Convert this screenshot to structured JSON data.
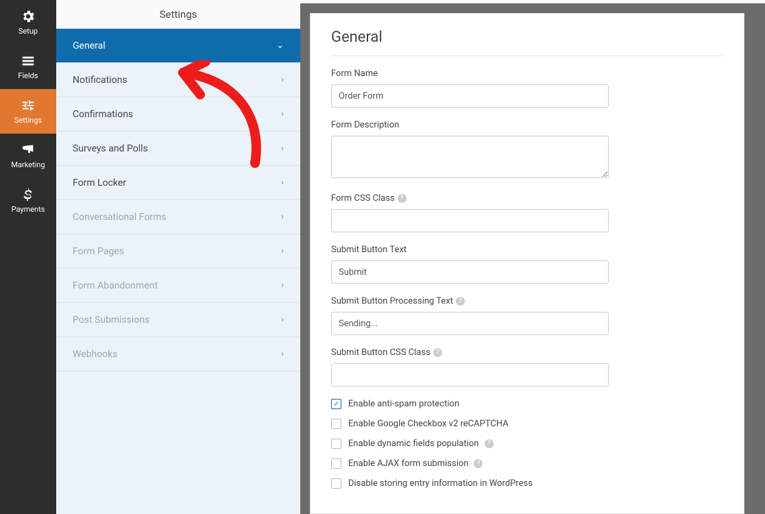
{
  "topbar": {
    "title": "Settings"
  },
  "vnav": [
    {
      "label": "Setup",
      "icon": "gear"
    },
    {
      "label": "Fields",
      "icon": "list"
    },
    {
      "label": "Settings",
      "icon": "sliders",
      "active": true
    },
    {
      "label": "Marketing",
      "icon": "bullhorn"
    },
    {
      "label": "Payments",
      "icon": "dollar"
    }
  ],
  "menu": [
    {
      "label": "General",
      "active": true,
      "chev": "down"
    },
    {
      "label": "Notifications"
    },
    {
      "label": "Confirmations"
    },
    {
      "label": "Surveys and Polls"
    },
    {
      "label": "Form Locker"
    },
    {
      "label": "Conversational Forms",
      "disabled": true
    },
    {
      "label": "Form Pages",
      "disabled": true
    },
    {
      "label": "Form Abandonment",
      "disabled": true
    },
    {
      "label": "Post Submissions",
      "disabled": true
    },
    {
      "label": "Webhooks",
      "disabled": true
    }
  ],
  "panel": {
    "heading": "General",
    "formName": {
      "label": "Form Name",
      "value": "Order Form"
    },
    "formDesc": {
      "label": "Form Description",
      "value": ""
    },
    "formCss": {
      "label": "Form CSS Class",
      "value": ""
    },
    "submitText": {
      "label": "Submit Button Text",
      "value": "Submit"
    },
    "submitProc": {
      "label": "Submit Button Processing Text",
      "value": "Sending..."
    },
    "submitCss": {
      "label": "Submit Button CSS Class",
      "value": ""
    },
    "checks": [
      {
        "label": "Enable anti-spam protection",
        "checked": true
      },
      {
        "label": "Enable Google Checkbox v2 reCAPTCHA",
        "checked": false
      },
      {
        "label": "Enable dynamic fields population",
        "checked": false,
        "help": true
      },
      {
        "label": "Enable AJAX form submission",
        "checked": false,
        "help": true
      },
      {
        "label": "Disable storing entry information in WordPress",
        "checked": false
      }
    ]
  }
}
